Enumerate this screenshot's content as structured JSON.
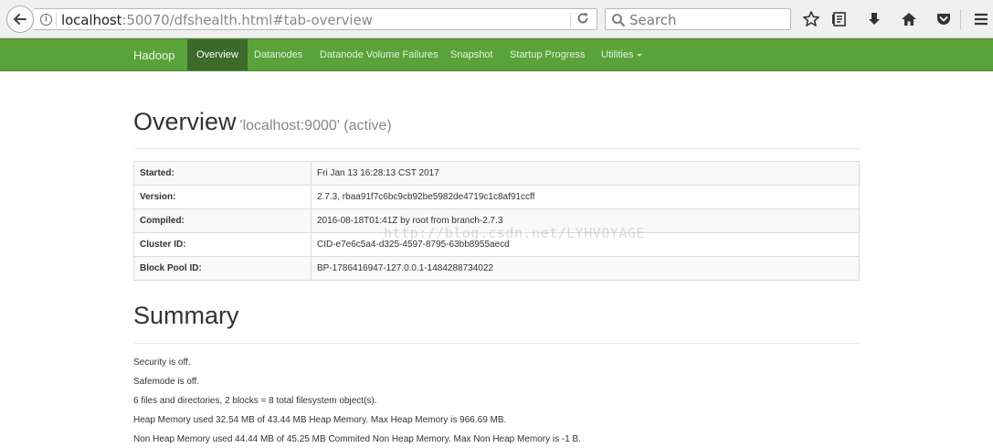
{
  "browser": {
    "url_host": "localhost",
    "url_rest": ":50070/dfshealth.html#tab-overview",
    "search_placeholder": "Search"
  },
  "navbar": {
    "brand": "Hadoop",
    "items": [
      {
        "label": "Overview",
        "active": true
      },
      {
        "label": "Datanodes"
      },
      {
        "label": "Datanode Volume Failures"
      },
      {
        "label": "Snapshot"
      },
      {
        "label": "Startup Progress"
      },
      {
        "label": "Utilities"
      }
    ]
  },
  "overview": {
    "title": "Overview",
    "subtitle": "'localhost:9000' (active)",
    "rows": [
      {
        "key": "Started:",
        "value": "Fri Jan 13 16:28:13 CST 2017"
      },
      {
        "key": "Version:",
        "value": "2.7.3, rbaa91f7c6bc9cb92be5982de4719c1c8af91ccff"
      },
      {
        "key": "Compiled:",
        "value": "2016-08-18T01:41Z by root from branch-2.7.3"
      },
      {
        "key": "Cluster ID:",
        "value": "CID-e7e6c5a4-d325-4597-8795-63bb8955aecd"
      },
      {
        "key": "Block Pool ID:",
        "value": "BP-1786416947-127.0.0.1-1484288734022"
      }
    ]
  },
  "summary": {
    "title": "Summary",
    "lines": [
      "Security is off.",
      "Safemode is off.",
      "6 files and directories, 2 blocks = 8 total filesystem object(s).",
      "Heap Memory used 32.54 MB of 43.44 MB Heap Memory. Max Heap Memory is 966.69 MB.",
      "Non Heap Memory used 44.44 MB of 45.25 MB Commited Non Heap Memory. Max Non Heap Memory is -1 B."
    ]
  },
  "watermark": "http://blog.csdn.net/LYHVOYAGE",
  "colors": {
    "navbar_bg": "#59a33a",
    "navbar_active_bg": "#3c6a2a"
  }
}
